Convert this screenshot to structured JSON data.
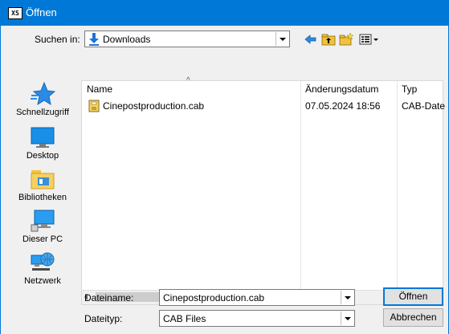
{
  "window": {
    "title": "Öffnen",
    "icon": "app-icon",
    "icon_text": "XS",
    "accent": "#0078d7"
  },
  "lookin": {
    "label": "Suchen in:",
    "value": "Downloads",
    "icon": "downloads-arrow-icon"
  },
  "toolbar": {
    "icons": [
      "back-icon",
      "up-folder-icon",
      "new-folder-icon",
      "view-menu-icon"
    ]
  },
  "places": [
    {
      "label": "Schnellzugriff",
      "icon": "quick-access-star-icon"
    },
    {
      "label": "Desktop",
      "icon": "desktop-icon"
    },
    {
      "label": "Bibliotheken",
      "icon": "libraries-icon"
    },
    {
      "label": "Dieser PC",
      "icon": "computer-icon"
    },
    {
      "label": "Netzwerk",
      "icon": "network-icon"
    }
  ],
  "list": {
    "columns": [
      "Name",
      "Änderungsdatum",
      "Typ"
    ],
    "sort_indicator": "^",
    "rows": [
      {
        "name": "Cinepostproduction.cab",
        "date": "07.05.2024 18:56",
        "type": "CAB-Date",
        "icon": "cab-file-icon"
      }
    ]
  },
  "filename": {
    "label": "Dateiname:",
    "value": "Cinepostproduction.cab"
  },
  "filetype": {
    "label": "Dateityp:",
    "value": "CAB Files"
  },
  "buttons": {
    "open": "Öffnen",
    "cancel": "Abbrechen"
  }
}
